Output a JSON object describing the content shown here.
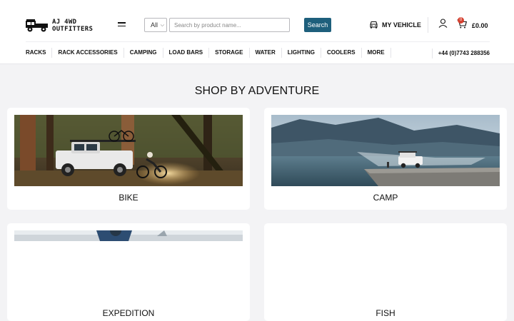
{
  "brand": {
    "name_line1": "AJ 4WD",
    "name_line2": "OUTFITTERS"
  },
  "search": {
    "category": "All",
    "placeholder": "Search by product name...",
    "button_label": "Search"
  },
  "vehicle": {
    "label": "MY VEHICLE"
  },
  "cart": {
    "count": "0",
    "total": "£0.00"
  },
  "nav": {
    "items": [
      {
        "label": "RACKS"
      },
      {
        "label": "RACK ACCESSORIES"
      },
      {
        "label": "CAMPING"
      },
      {
        "label": "LOAD BARS"
      },
      {
        "label": "STORAGE"
      },
      {
        "label": "WATER"
      },
      {
        "label": "LIGHTING"
      },
      {
        "label": "COOLERS"
      },
      {
        "label": "MORE"
      }
    ],
    "phone": "+44 (0)7743 288356"
  },
  "main": {
    "title": "SHOP BY ADVENTURE",
    "cards": [
      {
        "label": "BIKE"
      },
      {
        "label": "CAMP"
      },
      {
        "label": "EXPEDITION"
      },
      {
        "label": "FISH"
      }
    ]
  },
  "colors": {
    "accent": "#1e5f7c",
    "badge": "#d6402f",
    "page_bg": "#f3f3f5"
  }
}
